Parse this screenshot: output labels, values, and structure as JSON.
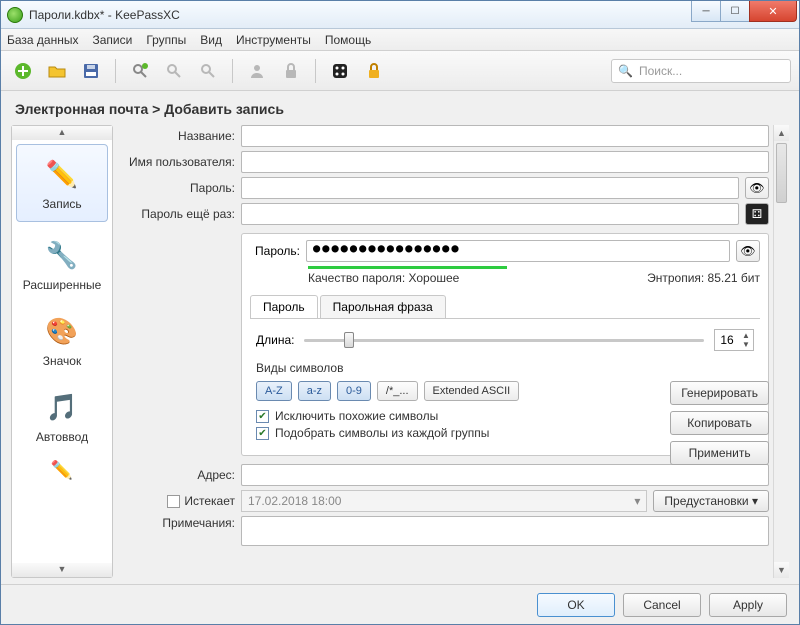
{
  "window": {
    "title": "Пароли.kdbx* - KeePassXC"
  },
  "menu": {
    "database": "База данных",
    "entries": "Записи",
    "groups": "Группы",
    "view": "Вид",
    "tools": "Инструменты",
    "help": "Помощь"
  },
  "toolbar": {
    "search_placeholder": "Поиск..."
  },
  "breadcrumb": "Электронная почта > Добавить запись",
  "sidenav": {
    "entry": "Запись",
    "advanced": "Расширенные",
    "icon": "Значок",
    "autotype": "Автоввод"
  },
  "form": {
    "title_label": "Название:",
    "username_label": "Имя пользователя:",
    "password_label": "Пароль:",
    "repeat_label": "Пароль ещё раз:",
    "url_label": "Адрес:",
    "expires_label": "Истекает",
    "expires_value": "17.02.2018 18:00",
    "presets": "Предустановки ▾",
    "notes_label": "Примечания:"
  },
  "gen": {
    "password_label": "Пароль:",
    "password_value": "●●●●●●●●●●●●●●●●",
    "quality_label": "Качество пароля: Хорошее",
    "entropy_label": "Энтропия: 85.21 бит",
    "tab_password": "Пароль",
    "tab_passphrase": "Парольная фраза",
    "length_label": "Длина:",
    "length_value": "16",
    "chartypes_label": "Виды символов",
    "t_upper": "A-Z",
    "t_lower": "a-z",
    "t_digits": "0-9",
    "t_special": "/*_...",
    "t_ext": "Extended ASCII",
    "chk_exclude": "Исключить похожие символы",
    "chk_each": "Подобрать символы из каждой группы",
    "btn_generate": "Генерировать",
    "btn_copy": "Копировать",
    "btn_apply": "Применить"
  },
  "footer": {
    "ok": "OK",
    "cancel": "Cancel",
    "apply": "Apply"
  }
}
